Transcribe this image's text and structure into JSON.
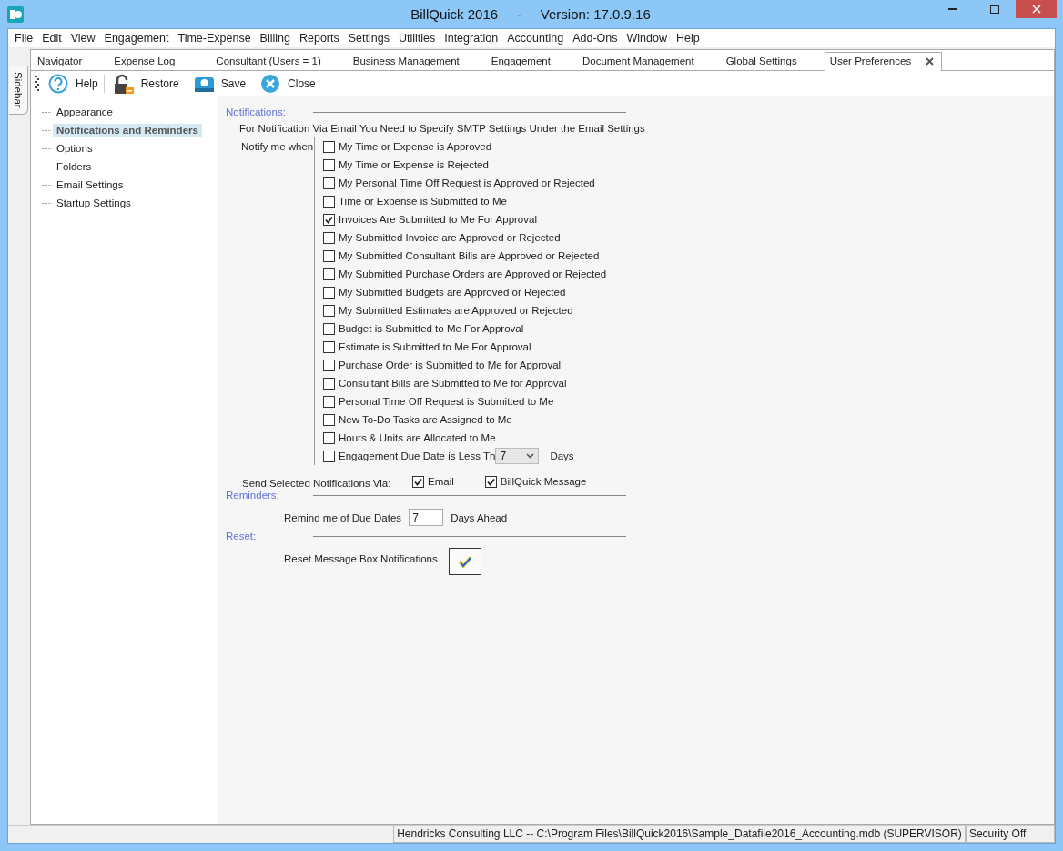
{
  "window": {
    "title": "BillQuick 2016     -     Version: 17.0.9.16"
  },
  "menu": [
    "File",
    "Edit",
    "View",
    "Engagement",
    "Time-Expense",
    "Billing",
    "Reports",
    "Settings",
    "Utilities",
    "Integration",
    "Accounting",
    "Add-Ons",
    "Window",
    "Help"
  ],
  "sidebar_tab": {
    "label": "Sidebar"
  },
  "tabs": [
    {
      "label": "Navigator",
      "selected": false
    },
    {
      "label": "Expense Log",
      "selected": false
    },
    {
      "label": "Consultant (Users = 1)",
      "selected": false
    },
    {
      "label": "Business Management",
      "selected": false
    },
    {
      "label": "Engagement",
      "selected": false
    },
    {
      "label": "Document Management",
      "selected": false
    },
    {
      "label": "Global Settings",
      "selected": false
    },
    {
      "label": "User Preferences",
      "selected": true
    }
  ],
  "toolbar": [
    {
      "kind": "help",
      "label": "Help"
    },
    {
      "kind": "restore",
      "label": "Restore"
    },
    {
      "kind": "save",
      "label": "Save"
    },
    {
      "kind": "close",
      "label": "Close"
    }
  ],
  "tree": [
    {
      "label": "Appearance",
      "selected": false
    },
    {
      "label": "Notifications and Reminders",
      "selected": true
    },
    {
      "label": "Options",
      "selected": false
    },
    {
      "label": "Folders",
      "selected": false
    },
    {
      "label": "Email Settings",
      "selected": false
    },
    {
      "label": "Startup Settings",
      "selected": false
    }
  ],
  "notifications": {
    "heading": "Notifications:",
    "info": "For Notification Via Email You Need to Specify SMTP Settings Under the Email Settings",
    "notify_label": "Notify me when",
    "options": [
      {
        "kind": "checkbox",
        "label": "My Time or Expense is Approved",
        "checked": false
      },
      {
        "kind": "checkbox",
        "label": "My Time or Expense is Rejected",
        "checked": false
      },
      {
        "kind": "checkbox",
        "label": "My Personal Time Off Request is Approved or Rejected",
        "checked": false
      },
      {
        "kind": "checkbox",
        "label": "Time or Expense is Submitted to Me",
        "checked": false
      },
      {
        "kind": "checkbox",
        "label": "Invoices Are Submitted to Me For Approval",
        "checked": true
      },
      {
        "kind": "checkbox",
        "label": "My Submitted Invoice are Approved or Rejected",
        "checked": false
      },
      {
        "kind": "checkbox",
        "label": "My Submitted Consultant Bills are Approved or Rejected",
        "checked": false
      },
      {
        "kind": "checkbox",
        "label": "My Submitted Purchase Orders are Approved or Rejected",
        "checked": false
      },
      {
        "kind": "checkbox",
        "label": "My Submitted Budgets are Approved or Rejected",
        "checked": false
      },
      {
        "kind": "checkbox",
        "label": "My Submitted Estimates are Approved or Rejected",
        "checked": false
      },
      {
        "kind": "checkbox",
        "label": "Budget is Submitted to Me For Approval",
        "checked": false
      },
      {
        "kind": "checkbox",
        "label": "Estimate is Submitted to Me For Approval",
        "checked": false
      },
      {
        "kind": "checkbox",
        "label": "Purchase Order is Submitted to Me for Approval",
        "checked": false
      },
      {
        "kind": "checkbox",
        "label": "Consultant Bills are Submitted to Me for Approval",
        "checked": false
      },
      {
        "kind": "checkbox",
        "label": "Personal Time Off Request is Submitted to Me",
        "checked": false
      },
      {
        "kind": "checkbox",
        "label": "New To-Do Tasks are Assigned to Me",
        "checked": false
      },
      {
        "kind": "checkbox",
        "label": "Hours & Units are Allocated to Me",
        "checked": false
      },
      {
        "kind": "dropdown",
        "label": "Engagement Due Date is Less Th",
        "checked": false,
        "value": "7",
        "unit": "Days"
      }
    ],
    "send_label": "Send Selected Notifications Via:",
    "send_options": [
      {
        "label": "Email",
        "checked": true
      },
      {
        "label": "BillQuick Message",
        "checked": true
      }
    ]
  },
  "reminders": {
    "heading": "Reminders:",
    "label": "Remind me of Due Dates",
    "value": "7",
    "unit": "Days Ahead"
  },
  "reset": {
    "heading": "Reset:",
    "label": "Reset Message Box Notifications"
  },
  "status_bar": [
    "Hendricks Consulting LLC -- C:\\Program Files\\BillQuick2016\\Sample_Datafile2016_Accounting.mdb (SUPERVISOR)",
    "Security Off"
  ]
}
